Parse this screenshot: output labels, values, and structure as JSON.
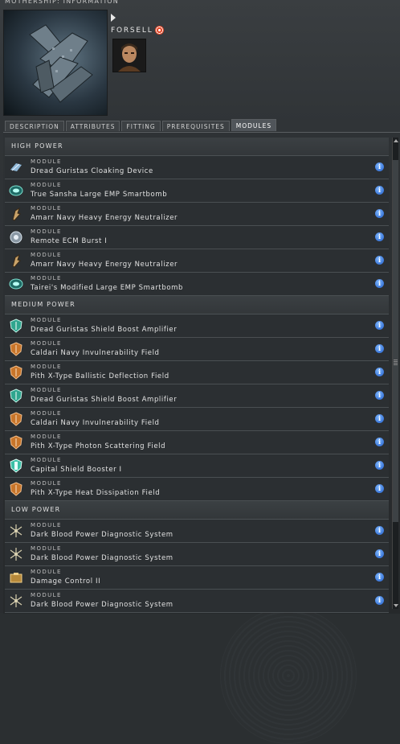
{
  "window": {
    "title": "MOTHERSHIP: INFORMATION"
  },
  "pilot": {
    "name": "FORSELL",
    "standing_icon": "eye-icon"
  },
  "tabs": [
    {
      "label": "DESCRIPTION",
      "active": false
    },
    {
      "label": "ATTRIBUTES",
      "active": false
    },
    {
      "label": "FITTING",
      "active": false
    },
    {
      "label": "PREREQUISITES",
      "active": false
    },
    {
      "label": "MODULES",
      "active": true
    }
  ],
  "groups": [
    {
      "label": "HIGH POWER",
      "items": [
        {
          "type": "MODULE",
          "name": "Dread Guristas Cloaking Device",
          "icon": "cloak-icon"
        },
        {
          "type": "MODULE",
          "name": "True Sansha Large EMP Smartbomb",
          "icon": "smartbomb-icon"
        },
        {
          "type": "MODULE",
          "name": "Amarr Navy Heavy Energy Neutralizer",
          "icon": "neutralizer-icon"
        },
        {
          "type": "MODULE",
          "name": "Remote ECM Burst I",
          "icon": "ecm-icon"
        },
        {
          "type": "MODULE",
          "name": "Amarr Navy Heavy Energy Neutralizer",
          "icon": "neutralizer-icon"
        },
        {
          "type": "MODULE",
          "name": "Tairei's Modified Large EMP Smartbomb",
          "icon": "smartbomb-icon"
        }
      ]
    },
    {
      "label": "MEDIUM POWER",
      "items": [
        {
          "type": "MODULE",
          "name": "Dread Guristas Shield Boost Amplifier",
          "icon": "shield-amp-icon"
        },
        {
          "type": "MODULE",
          "name": "Caldari Navy Invulnerability Field",
          "icon": "shield-field-icon"
        },
        {
          "type": "MODULE",
          "name": "Pith X-Type Ballistic Deflection Field",
          "icon": "shield-field-icon"
        },
        {
          "type": "MODULE",
          "name": "Dread Guristas Shield Boost Amplifier",
          "icon": "shield-amp-icon"
        },
        {
          "type": "MODULE",
          "name": "Caldari Navy Invulnerability Field",
          "icon": "shield-field-icon"
        },
        {
          "type": "MODULE",
          "name": "Pith X-Type Photon Scattering Field",
          "icon": "shield-field-icon"
        },
        {
          "type": "MODULE",
          "name": "Capital Shield Booster I",
          "icon": "shield-booster-icon"
        },
        {
          "type": "MODULE",
          "name": "Pith X-Type Heat Dissipation Field",
          "icon": "shield-field-icon"
        }
      ]
    },
    {
      "label": "LOW POWER",
      "items": [
        {
          "type": "MODULE",
          "name": "Dark Blood Power Diagnostic System",
          "icon": "power-diagnostic-icon"
        },
        {
          "type": "MODULE",
          "name": "Dark Blood Power Diagnostic System",
          "icon": "power-diagnostic-icon"
        },
        {
          "type": "MODULE",
          "name": "Damage Control II",
          "icon": "damage-control-icon"
        },
        {
          "type": "MODULE",
          "name": "Dark Blood Power Diagnostic System",
          "icon": "power-diagnostic-icon"
        }
      ]
    }
  ],
  "colors": {
    "info": "#2f6fd6",
    "shield_orange": "#d07a2a",
    "shield_teal": "#39b7a0"
  }
}
